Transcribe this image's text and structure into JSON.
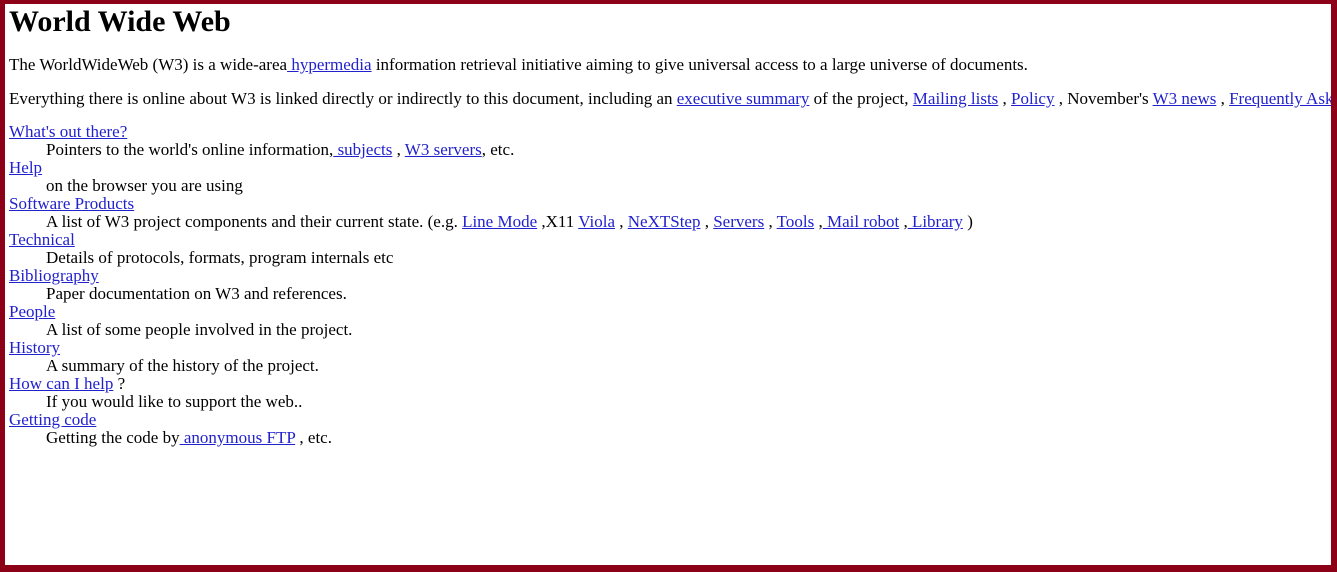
{
  "page": {
    "title": "World Wide Web",
    "border_color": "#8c0018",
    "link_color": "#2222cc",
    "text_color": "#000000",
    "background_color": "#ffffff"
  },
  "paragraphs": [
    {
      "name": "intro-paragraph",
      "parts": [
        {
          "type": "text",
          "text": "The WorldWideWeb (W3) is a wide-area"
        },
        {
          "type": "link",
          "text": " hypermedia"
        },
        {
          "type": "text",
          "text": " information retrieval initiative aiming to give universal access to a large universe of documents."
        }
      ]
    },
    {
      "name": "everything-paragraph",
      "parts": [
        {
          "type": "text",
          "text": "Everything there is online about W3 is linked directly or indirectly to this document, including an "
        },
        {
          "type": "link",
          "text": "executive summary"
        },
        {
          "type": "text",
          "text": " of the project, "
        },
        {
          "type": "link",
          "text": "Mailing lists"
        },
        {
          "type": "text",
          "text": " , "
        },
        {
          "type": "link",
          "text": "Policy"
        },
        {
          "type": "text",
          "text": " , November's "
        },
        {
          "type": "link",
          "text": "W3 news"
        },
        {
          "type": "text",
          "text": " , "
        },
        {
          "type": "link",
          "text": "Frequently Asked Questions"
        }
      ]
    }
  ],
  "menu": [
    {
      "term": {
        "text": "What's out there?",
        "link": true
      },
      "def_parts": [
        {
          "type": "text",
          "text": "Pointers to the world's online information,"
        },
        {
          "type": "link",
          "text": " subjects"
        },
        {
          "type": "text",
          "text": " , "
        },
        {
          "type": "link",
          "text": "W3 servers"
        },
        {
          "type": "text",
          "text": ", etc."
        }
      ]
    },
    {
      "term": {
        "text": "Help",
        "link": true
      },
      "def_parts": [
        {
          "type": "text",
          "text": "on the browser you are using"
        }
      ]
    },
    {
      "term": {
        "text": "Software Products",
        "link": true
      },
      "def_parts": [
        {
          "type": "text",
          "text": "A list of W3 project components and their current state. (e.g. "
        },
        {
          "type": "link",
          "text": "Line Mode"
        },
        {
          "type": "text",
          "text": " ,X11 "
        },
        {
          "type": "link",
          "text": "Viola"
        },
        {
          "type": "text",
          "text": " , "
        },
        {
          "type": "link",
          "text": "NeXTStep"
        },
        {
          "type": "text",
          "text": " , "
        },
        {
          "type": "link",
          "text": "Servers"
        },
        {
          "type": "text",
          "text": " , "
        },
        {
          "type": "link",
          "text": "Tools"
        },
        {
          "type": "text",
          "text": " ,"
        },
        {
          "type": "link",
          "text": " Mail robot"
        },
        {
          "type": "text",
          "text": " ,"
        },
        {
          "type": "link",
          "text": " Library"
        },
        {
          "type": "text",
          "text": " )"
        }
      ]
    },
    {
      "term": {
        "text": "Technical",
        "link": true
      },
      "def_parts": [
        {
          "type": "text",
          "text": "Details of protocols, formats, program internals etc"
        }
      ]
    },
    {
      "term": {
        "text": "Bibliography",
        "link": true
      },
      "def_parts": [
        {
          "type": "text",
          "text": "Paper documentation on W3 and references."
        }
      ]
    },
    {
      "term": {
        "text": "People",
        "link": true
      },
      "def_parts": [
        {
          "type": "text",
          "text": "A list of some people involved in the project."
        }
      ]
    },
    {
      "term": {
        "text": "History",
        "link": true
      },
      "def_parts": [
        {
          "type": "text",
          "text": "A summary of the history of the project."
        }
      ]
    },
    {
      "term": {
        "text": "How can I help",
        "link": true,
        "suffix": " ?"
      },
      "def_parts": [
        {
          "type": "text",
          "text": "If you would like to support the web.."
        }
      ]
    },
    {
      "term": {
        "text": "Getting code",
        "link": true
      },
      "def_parts": [
        {
          "type": "text",
          "text": "Getting the code by"
        },
        {
          "type": "link",
          "text": " anonymous FTP"
        },
        {
          "type": "text",
          "text": " , etc."
        }
      ]
    }
  ]
}
